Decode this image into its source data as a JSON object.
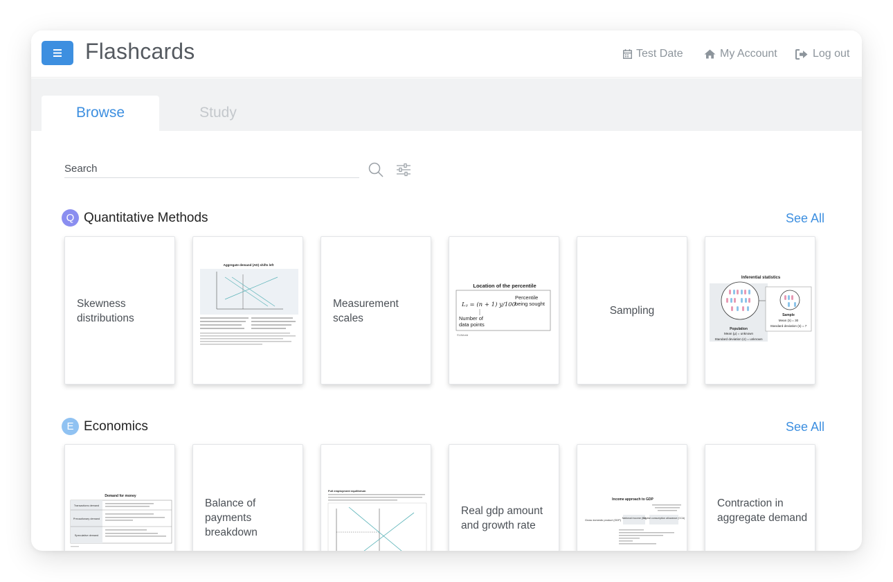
{
  "header": {
    "title": "Flashcards",
    "nav": [
      {
        "label": "Test Date",
        "icon": "calendar-icon"
      },
      {
        "label": "My Account",
        "icon": "home-icon"
      },
      {
        "label": "Log out",
        "icon": "logout-icon"
      }
    ]
  },
  "tabs": [
    {
      "label": "Browse",
      "active": true
    },
    {
      "label": "Study",
      "active": false
    }
  ],
  "search": {
    "placeholder": "Search",
    "value": ""
  },
  "colors": {
    "accent": "#3d8fe0",
    "badge_q": "#8a8ef0",
    "badge_e": "#90c2f2"
  },
  "sections": [
    {
      "letter": "Q",
      "title": "Quantitative Methods",
      "see_all": "See All",
      "cards": [
        {
          "text": "Skewness distributions"
        },
        {
          "figure": {
            "title": "Aggregate demand (AD) shifts left"
          }
        },
        {
          "text": "Measurement scales"
        },
        {
          "figure": {
            "title": "Location of the percentile",
            "formula": "Lᵧ = (n + 1) y/100",
            "label_right": "Percentile being sought",
            "label_below": "Number of data points",
            "credit": "©UWorld"
          }
        },
        {
          "text": "Sampling"
        },
        {
          "figure": {
            "title": "Inferential statistics",
            "population": "Population",
            "pop_mean": "Mean (μ) = unknown",
            "pop_sd": "Standard deviation (σ) = unknown",
            "sample": "Sample",
            "sample_mean": "Mean (x̄) = 30",
            "sample_sd": "Standard deviation (s) = 7"
          }
        }
      ]
    },
    {
      "letter": "E",
      "title": "Economics",
      "see_all": "See All",
      "cards": [
        {
          "figure": {
            "title": "Demand for money",
            "rows": [
              "Transactions demand",
              "Precautionary demand",
              "Speculative demand"
            ]
          }
        },
        {
          "text": "Balance of payments breakdown"
        },
        {
          "figure": {
            "title": "Full employment equilibrium"
          }
        },
        {
          "text": "Real gdp amount and growth rate"
        },
        {
          "figure": {
            "title": "Income approach to GDP",
            "left": "Gross domestic product (GDP)",
            "mid": "National income (NI)",
            "right": "Capital consumption allowance (CCA)"
          }
        },
        {
          "text": "Contraction in aggregate demand"
        }
      ]
    }
  ]
}
